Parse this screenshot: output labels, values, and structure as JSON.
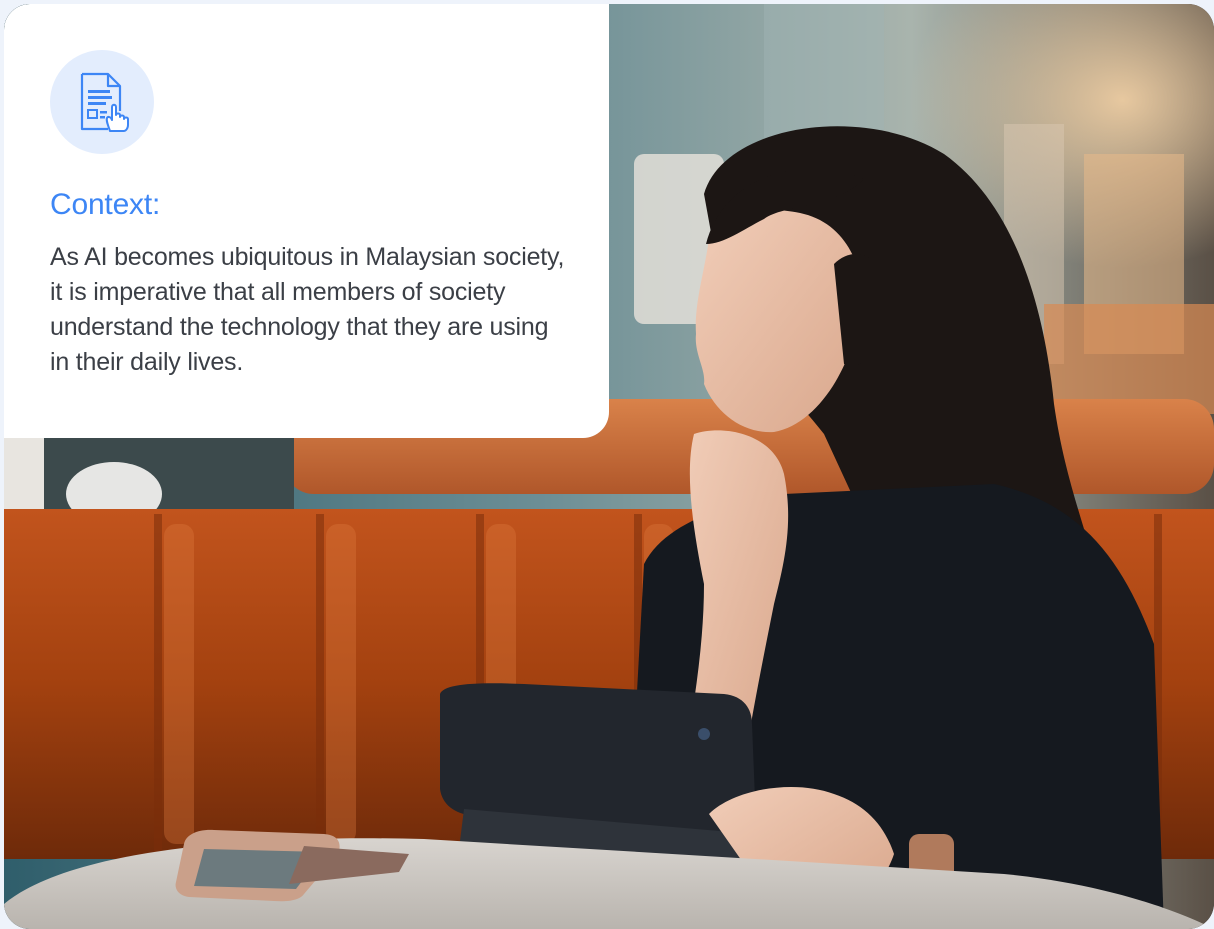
{
  "context": {
    "icon": "document-hand-pointer-icon",
    "title": "Context:",
    "body": "As AI becomes ubiquitous in Malaysian society, it is imperative that all members of society understand the technology that they are using in their daily lives."
  },
  "colors": {
    "accent": "#3d86f5",
    "icon_bg": "#e3edfd",
    "body_text": "#3b3f46",
    "card_bg": "#ffffff"
  },
  "photo": {
    "subject": "woman-with-tablet-in-cafe"
  }
}
